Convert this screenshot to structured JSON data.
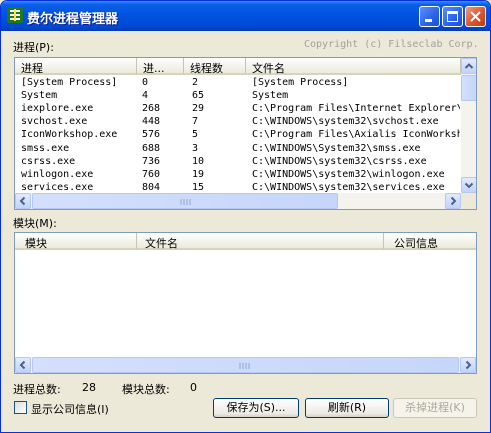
{
  "window": {
    "title": "费尔进程管理器"
  },
  "process_section": {
    "label": "进程(P):",
    "copyright": "Copyright (c) Filseclab Corp.",
    "columns": [
      "进程",
      "进...",
      "线程数",
      "文件名"
    ],
    "rows": [
      [
        "[System Process]",
        "0",
        "2",
        "[System Process]"
      ],
      [
        "System",
        "4",
        "65",
        "System"
      ],
      [
        "iexplore.exe",
        "268",
        "29",
        "C:\\Program Files\\Internet Explorer\\"
      ],
      [
        "svchost.exe",
        "448",
        "7",
        "C:\\WINDOWS\\system32\\svchost.exe"
      ],
      [
        "IconWorkshop.exe",
        "576",
        "5",
        "C:\\Program Files\\Axialis IconWorksh"
      ],
      [
        "smss.exe",
        "688",
        "3",
        "C:\\WINDOWS\\System32\\smss.exe"
      ],
      [
        "csrss.exe",
        "736",
        "10",
        "C:\\WINDOWS\\system32\\csrss.exe"
      ],
      [
        "winlogon.exe",
        "760",
        "19",
        "C:\\WINDOWS\\system32\\winlogon.exe"
      ],
      [
        "services.exe",
        "804",
        "15",
        "C:\\WINDOWS\\system32\\services.exe"
      ]
    ]
  },
  "module_section": {
    "label": "模块(M):",
    "columns": [
      "模块",
      "文件名",
      "公司信息"
    ]
  },
  "status": {
    "process_total_label": "进程总数:",
    "process_total": "28",
    "module_total_label": "模块总数:",
    "module_total": "0"
  },
  "options": {
    "show_company_label": "显示公司信息(I)",
    "show_company_checked": false
  },
  "buttons": {
    "save_as": "保存为(S)...",
    "refresh": "刷新(R)",
    "kill": "杀掉进程(K)"
  }
}
